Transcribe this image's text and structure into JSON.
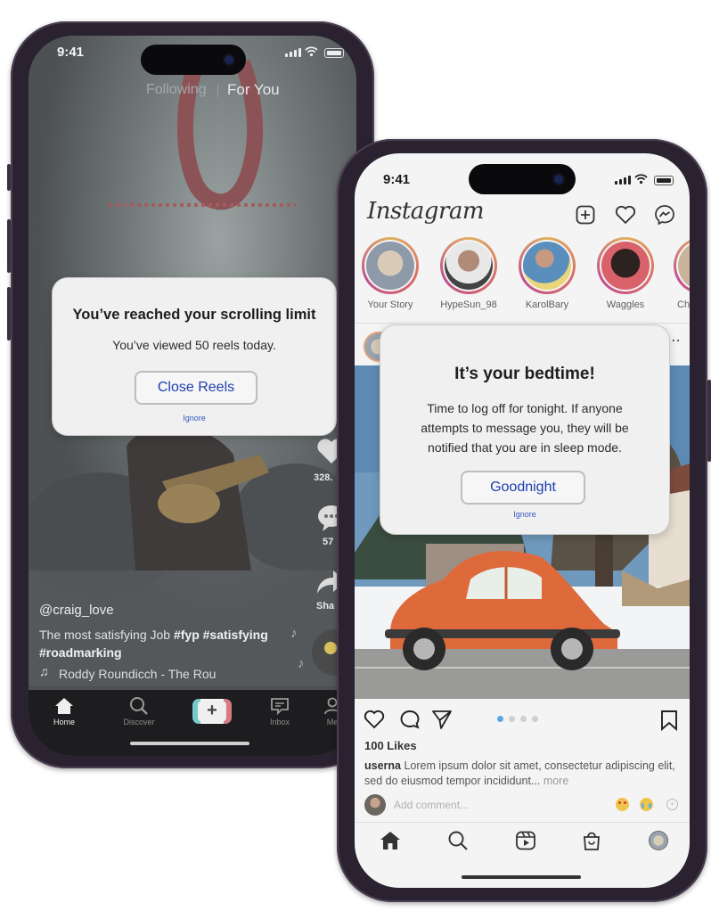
{
  "tiktok": {
    "status_time": "9:41",
    "tab_following": "Following",
    "tab_for_you": "For You",
    "username": "@craig_love",
    "caption_text": "The most satisfying Job ",
    "hashtags_line1": "#fyp #satisfying",
    "hashtag_line2": "#roadmarking",
    "music": "Roddy Roundicch - The Rou",
    "like_count": "328.",
    "comment_count": "57",
    "share_label": "Sha",
    "nav": {
      "home": "Home",
      "discover": "Discover",
      "inbox": "Inbox",
      "me": "Me",
      "add_symbol": "+"
    },
    "dialog": {
      "title": "You’ve reached your scrolling limit",
      "message": "You’ve viewed 50 reels today.",
      "button": "Close Reels",
      "ignore": "Ignore"
    }
  },
  "instagram": {
    "status_time": "9:41",
    "logo": "Instagram",
    "stories": [
      {
        "name": "Your Story"
      },
      {
        "name": "HypeSun_98"
      },
      {
        "name": "KarolBary"
      },
      {
        "name": "Waggles"
      },
      {
        "name": "Ch"
      }
    ],
    "post": {
      "likes": "100 Likes",
      "caption_user": "userna",
      "caption_text": " Lorem ipsum dolor sit amet, consectetur adipiscing elit, sed do eiusmod tempor incididunt...",
      "more": " more",
      "comment_placeholder": "Add comment...",
      "carousel_count": 4,
      "carousel_active": 1
    },
    "dialog": {
      "title": "It’s your bedtime!",
      "message": "Time to log off for tonight. If anyone attempts to message you, they will be notified that you are in sleep mode.",
      "button": "Goodnight",
      "ignore": "Ignore"
    }
  },
  "colors": {
    "phone_frame": "#2a2230",
    "dialog_bg": "#f0f0f0",
    "button_text": "#1c3fae",
    "tiktok_overlay": "#6a6a6a",
    "instagram_bg": "#f4f4f4"
  }
}
